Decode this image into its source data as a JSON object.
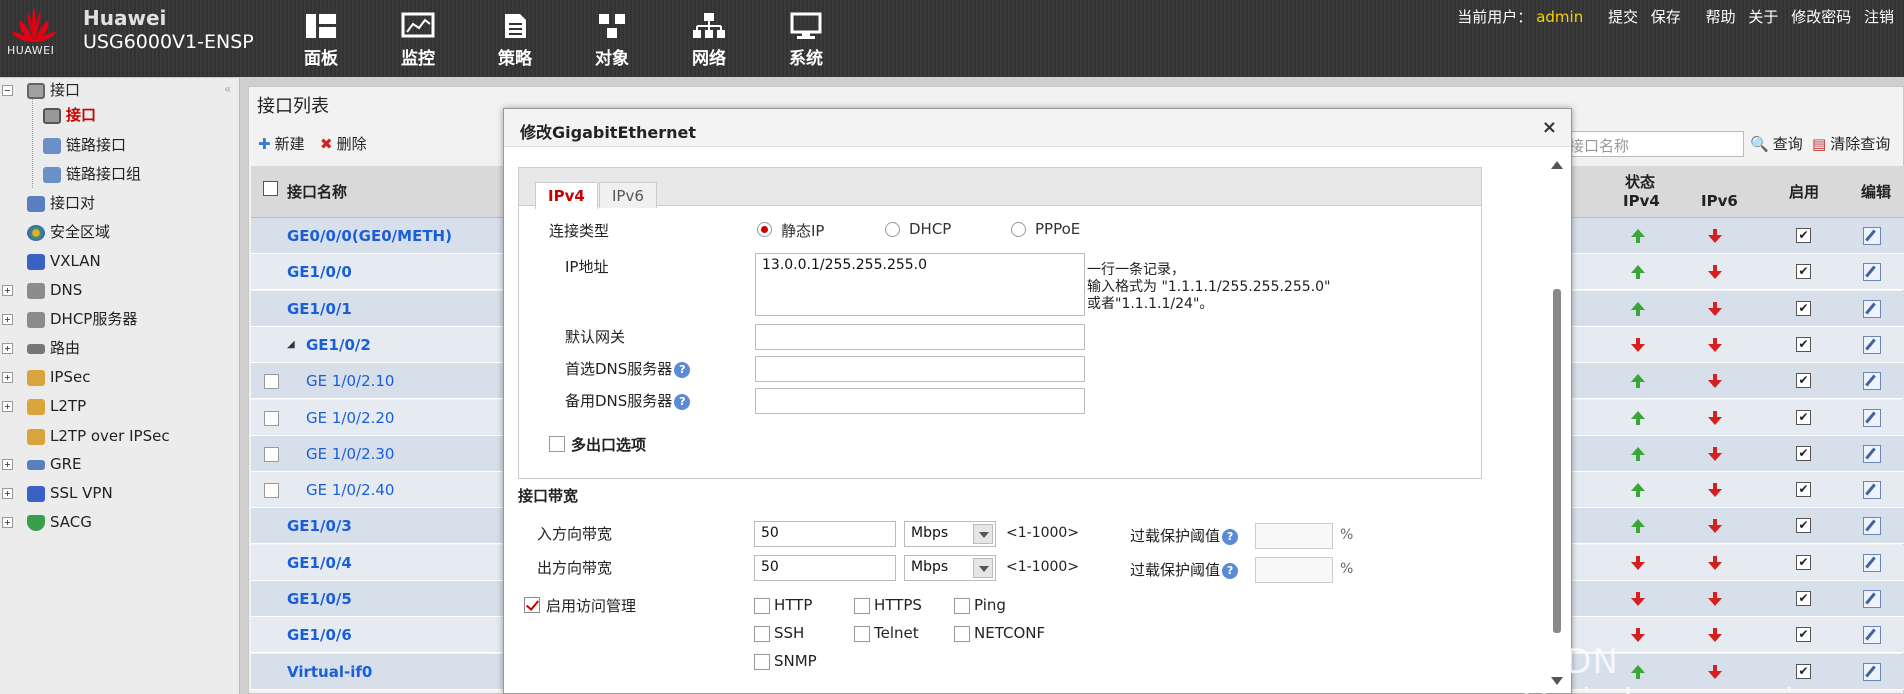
{
  "header": {
    "brand": "Huawei",
    "logo_text": "HUAWEI",
    "model": "USG6000V1-ENSP",
    "nav": [
      {
        "label": "面板",
        "icon": "dashboard-icon"
      },
      {
        "label": "监控",
        "icon": "monitor-icon"
      },
      {
        "label": "策略",
        "icon": "policy-icon"
      },
      {
        "label": "对象",
        "icon": "object-icon"
      },
      {
        "label": "网络",
        "icon": "network-icon"
      },
      {
        "label": "系统",
        "icon": "system-icon"
      }
    ],
    "current_user_label": "当前用户：",
    "current_user": "admin",
    "actions": [
      "提交",
      "保存",
      "帮助",
      "关于",
      "修改密码",
      "注销"
    ]
  },
  "sidebar": {
    "items": [
      {
        "label": "接口",
        "icon": "interface-folder-icon"
      },
      {
        "label": "接口",
        "icon": "interface-icon"
      },
      {
        "label": "链路接口",
        "icon": "link-interface-icon"
      },
      {
        "label": "链路接口组",
        "icon": "link-group-icon"
      },
      {
        "label": "接口对",
        "icon": "interface-pair-icon"
      },
      {
        "label": "安全区域",
        "icon": "security-zone-icon"
      },
      {
        "label": "VXLAN",
        "icon": "vxlan-icon"
      },
      {
        "label": "DNS",
        "icon": "dns-icon"
      },
      {
        "label": "DHCP服务器",
        "icon": "dhcp-icon"
      },
      {
        "label": "路由",
        "icon": "route-icon"
      },
      {
        "label": "IPSec",
        "icon": "ipsec-icon"
      },
      {
        "label": "L2TP",
        "icon": "l2tp-icon"
      },
      {
        "label": "L2TP over IPSec",
        "icon": "l2tp-ipsec-icon"
      },
      {
        "label": "GRE",
        "icon": "gre-icon"
      },
      {
        "label": "SSL VPN",
        "icon": "sslvpn-icon"
      },
      {
        "label": "SACG",
        "icon": "sacg-icon"
      }
    ]
  },
  "panel": {
    "title": "接口列表",
    "new_label": "新建",
    "delete_label": "删除",
    "search_placeholder": "接口名称",
    "query_label": "查询",
    "clear_label": "清除查询",
    "col_name": "接口名称",
    "col_status": "状态",
    "col_ipv4": "IPv4",
    "col_ipv6": "IPv6",
    "col_enable": "启用",
    "col_edit": "编辑",
    "rows": [
      {
        "name": "GE0/0/0(GE0/METH)",
        "sub": false,
        "ipv4": "up",
        "ipv6": "down"
      },
      {
        "name": "GE1/0/0",
        "sub": false,
        "ipv4": "up",
        "ipv6": "down"
      },
      {
        "name": "GE1/0/1",
        "sub": false,
        "ipv4": "up",
        "ipv6": "down"
      },
      {
        "name": "GE1/0/2",
        "sub": false,
        "ipv4": "down",
        "ipv6": "down"
      },
      {
        "name": "GE 1/0/2.10",
        "sub": true,
        "ipv4": "up",
        "ipv6": "down"
      },
      {
        "name": "GE 1/0/2.20",
        "sub": true,
        "ipv4": "up",
        "ipv6": "down"
      },
      {
        "name": "GE 1/0/2.30",
        "sub": true,
        "ipv4": "up",
        "ipv6": "down"
      },
      {
        "name": "GE 1/0/2.40",
        "sub": true,
        "ipv4": "up",
        "ipv6": "down"
      },
      {
        "name": "GE1/0/3",
        "sub": false,
        "ipv4": "up",
        "ipv6": "down"
      },
      {
        "name": "GE1/0/4",
        "sub": false,
        "ipv4": "down",
        "ipv6": "down"
      },
      {
        "name": "GE1/0/5",
        "sub": false,
        "ipv4": "down",
        "ipv6": "down"
      },
      {
        "name": "GE1/0/6",
        "sub": false,
        "ipv4": "down",
        "ipv6": "down"
      },
      {
        "name": "Virtual-if0",
        "sub": false,
        "ipv4": "up",
        "ipv6": "down"
      }
    ]
  },
  "modal": {
    "title": "修改GigabitEthernet",
    "close": "×",
    "tabs": [
      "IPv4",
      "IPv6"
    ],
    "conn_type_label": "连接类型",
    "conn_options": [
      "静态IP",
      "DHCP",
      "PPPoE"
    ],
    "ip_label": "IP地址",
    "ip_value": "13.0.0.1/255.255.255.0",
    "ip_hint": [
      "一行一条记录，",
      "输入格式为 \"1.1.1.1/255.255.255.0\"",
      "或者\"1.1.1.1/24\"。"
    ],
    "gateway_label": "默认网关",
    "dns1_label": "首选DNS服务器",
    "dns2_label": "备用DNS服务器",
    "help_glyph": "?",
    "multi_exit_label": "多出口选项",
    "bandwidth_title": "接口带宽",
    "in_bw_label": "入方向带宽",
    "out_bw_label": "出方向带宽",
    "in_bw_value": "50",
    "out_bw_value": "50",
    "unit": "Mbps",
    "range": "<1-1000>",
    "overload_label": "过载保护阈值",
    "pct": "%",
    "access_label": "启用访问管理",
    "services": [
      "HTTP",
      "HTTPS",
      "Ping",
      "SSH",
      "Telnet",
      "NETCONF",
      "SNMP"
    ]
  },
  "watermark": "CSDN @wisdom_serein",
  "colors": {
    "accent": "#cc0000",
    "link": "#1b5fd6",
    "up": "#3aa635",
    "down": "#d62020"
  }
}
